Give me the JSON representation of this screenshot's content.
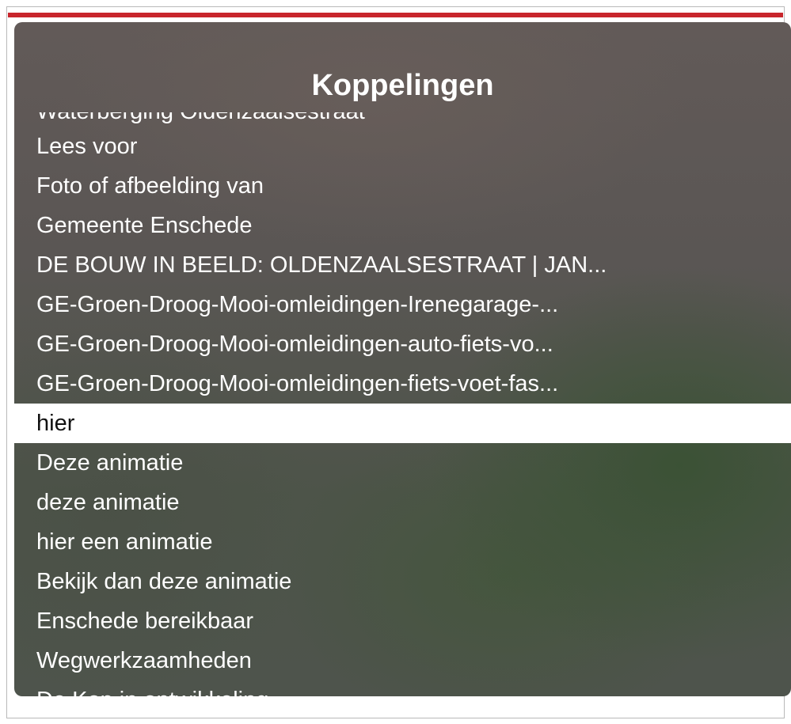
{
  "rotor": {
    "title": "Koppelingen",
    "partial_item": "Waterberging Oldenzaalsestraat",
    "items": [
      "Lees voor",
      "Foto of afbeelding van",
      "Gemeente Enschede",
      "DE BOUW IN BEELD: OLDENZAALSESTRAAT | JAN...",
      "GE-Groen-Droog-Mooi-omleidingen-Irenegarage-...",
      "GE-Groen-Droog-Mooi-omleidingen-auto-fiets-vo...",
      "GE-Groen-Droog-Mooi-omleidingen-fiets-voet-fas...",
      "hier",
      "Deze animatie",
      "deze animatie",
      "hier een animatie",
      "Bekijk dan deze animatie",
      "Enschede bereikbaar",
      "Wegwerkzaamheden",
      "De Kop in ontwikkeling"
    ]
  },
  "colors": {
    "header_bar": "#c8262c",
    "selected_background": "#ffffff",
    "item_text": "#ffffff"
  }
}
